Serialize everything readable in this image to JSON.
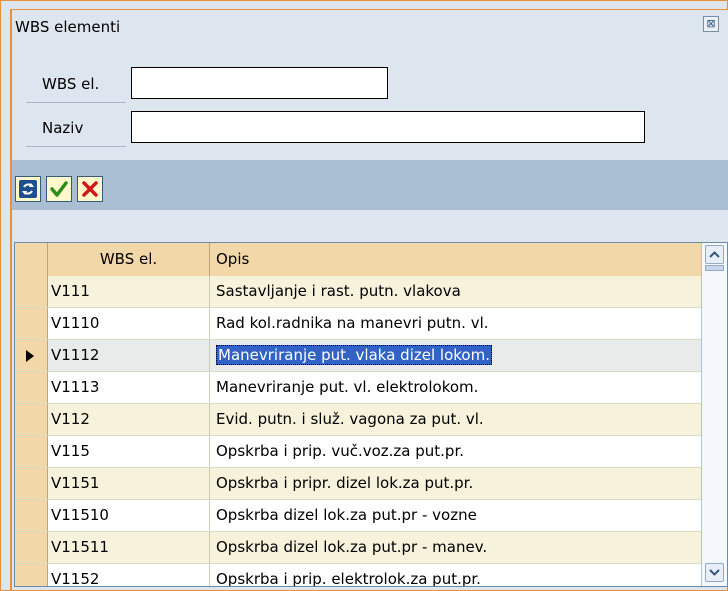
{
  "window": {
    "title": "WBS elementi",
    "close_glyph": "⊠"
  },
  "form": {
    "wbs_label": "WBS el.",
    "wbs_value": "",
    "naziv_label": "Naziv",
    "naziv_value": ""
  },
  "toolbar": {
    "buttons": [
      {
        "name": "refresh-icon"
      },
      {
        "name": "checkmark-icon",
        "color": "#2e8b1a"
      },
      {
        "name": "cancel-icon",
        "color": "#d01818"
      }
    ]
  },
  "table": {
    "columns": [
      "WBS el.",
      "Opis"
    ],
    "rows": [
      {
        "wbs": "V111",
        "opis": "Sastavljanje i rast. putn. vlakova",
        "style": "tinted"
      },
      {
        "wbs": "V1110",
        "opis": "Rad kol.radnika na manevri putn. vl.",
        "style": "plain"
      },
      {
        "wbs": "V1112",
        "opis": "Manevriranje put. vlaka dizel lokom.",
        "style": "selected"
      },
      {
        "wbs": "V1113",
        "opis": "Manevriranje put. vl. elektrolokom.",
        "style": "plain"
      },
      {
        "wbs": "V112",
        "opis": "Evid. putn. i služ. vagona za put. vl.",
        "style": "tinted"
      },
      {
        "wbs": "V115",
        "opis": "Opskrba i prip. vuč.voz.za put.pr.",
        "style": "plain"
      },
      {
        "wbs": "V1151",
        "opis": "Opskrba i pripr. dizel lok.za put.pr.",
        "style": "tinted"
      },
      {
        "wbs": "V11510",
        "opis": "Opskrba dizel lok.za put.pr - vozne",
        "style": "plain"
      },
      {
        "wbs": "V11511",
        "opis": "Opskrba dizel lok.za put.pr - manev.",
        "style": "tinted"
      },
      {
        "wbs": "V1152",
        "opis": "Opskrba i prip. elektrolok.za put.pr.",
        "style": "plain"
      }
    ]
  },
  "colors": {
    "frame": "#e8913a",
    "panel": "#dde6ef",
    "toolbar": "#a9bdd3",
    "header": "#f2d7a8",
    "selection": "#3163c5"
  }
}
